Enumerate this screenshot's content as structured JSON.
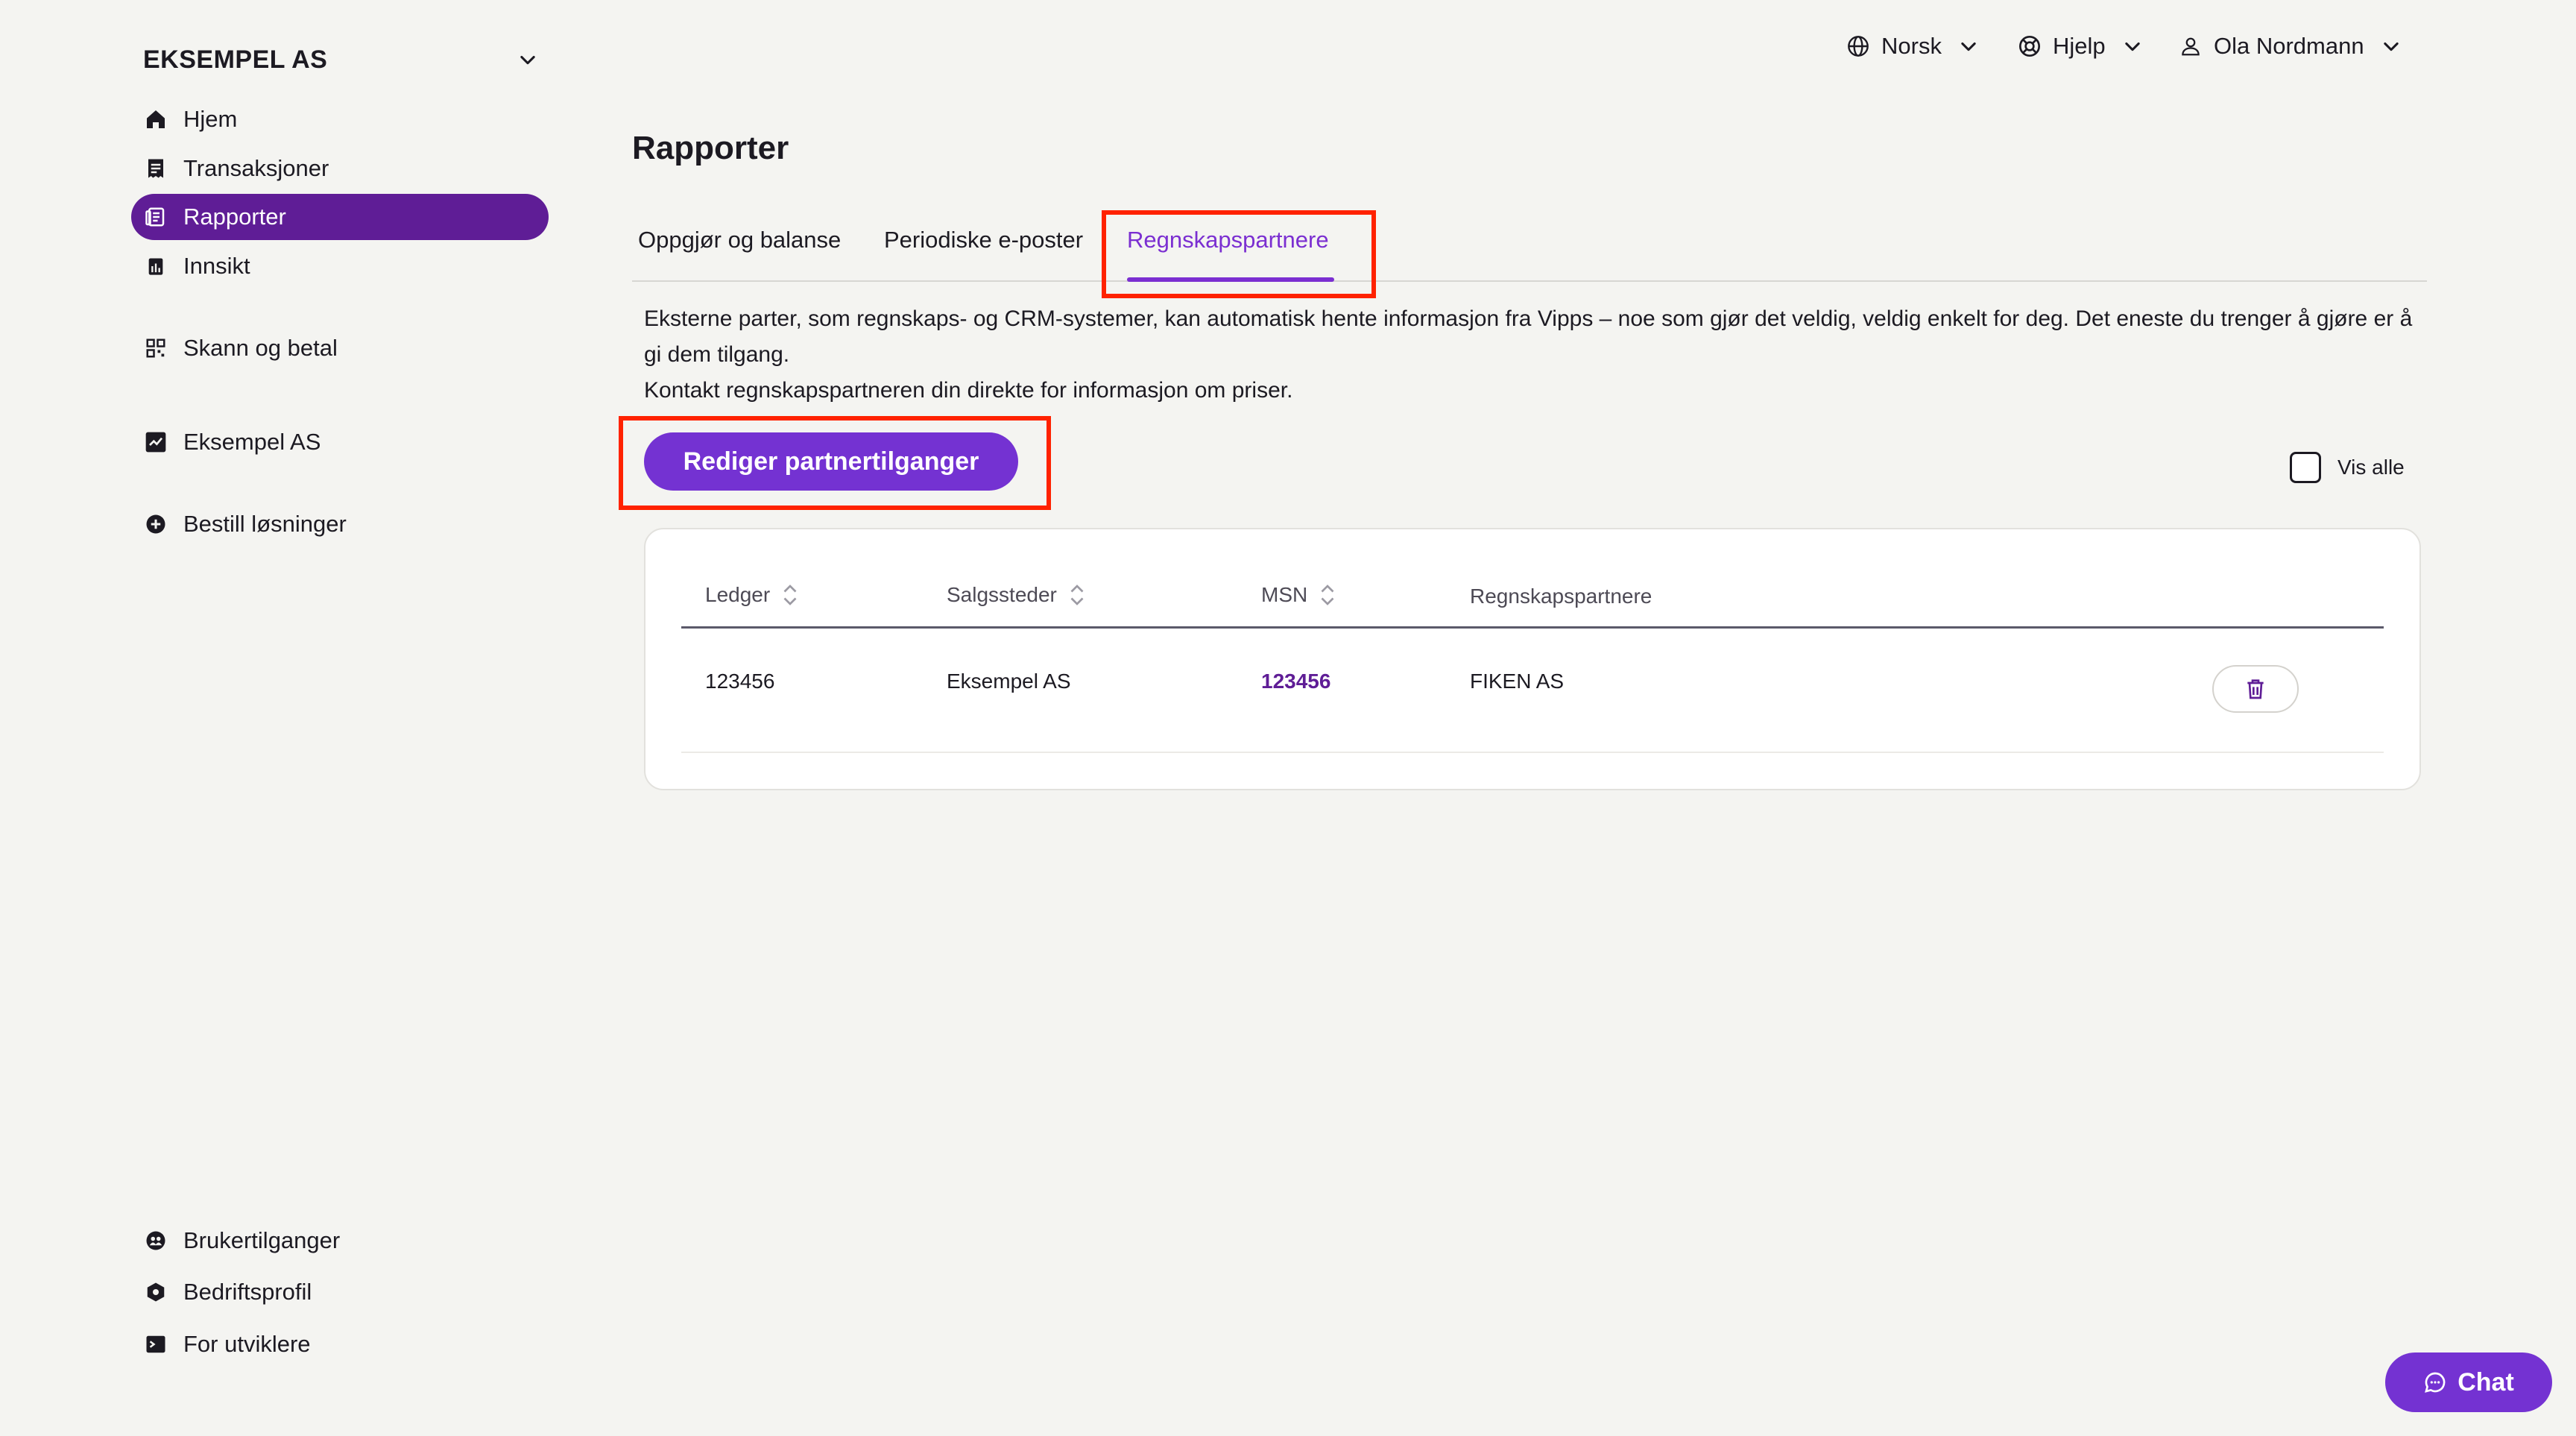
{
  "sidebar": {
    "company": "EKSEMPEL AS",
    "items": [
      {
        "label": "Hjem",
        "icon": "home-icon"
      },
      {
        "label": "Transaksjoner",
        "icon": "receipt-icon"
      },
      {
        "label": "Rapporter",
        "icon": "report-icon"
      },
      {
        "label": "Innsikt",
        "icon": "insight-icon"
      },
      {
        "label": "Skann og betal",
        "icon": "qr-icon"
      },
      {
        "label": "Eksempel AS",
        "icon": "store-icon"
      },
      {
        "label": "Bestill løsninger",
        "icon": "plus-circle-icon"
      }
    ],
    "bottom_items": [
      {
        "label": "Brukertilganger",
        "icon": "users-icon"
      },
      {
        "label": "Bedriftsprofil",
        "icon": "hexagon-icon"
      },
      {
        "label": "For utviklere",
        "icon": "terminal-icon"
      }
    ]
  },
  "topbar": {
    "language": "Norsk",
    "help": "Hjelp",
    "user": "Ola Nordmann"
  },
  "main": {
    "title": "Rapporter",
    "tabs": [
      {
        "label": "Oppgjør og balanse",
        "active": false
      },
      {
        "label": "Periodiske e-poster",
        "active": false
      },
      {
        "label": "Regnskapspartnere",
        "active": true
      }
    ],
    "description_line1": "Eksterne parter, som regnskaps- og CRM-systemer, kan automatisk hente informasjon fra Vipps – noe som gjør det veldig, veldig enkelt for deg. Det eneste du trenger å gjøre er å gi dem tilgang.",
    "description_line2": "Kontakt regnskapspartneren din direkte for informasjon om priser.",
    "edit_button": "Rediger partnertilganger",
    "show_all_label": "Vis alle",
    "show_all_checked": false
  },
  "table": {
    "columns": [
      "Ledger",
      "Salgssteder",
      "MSN",
      "Regnskapspartnere"
    ],
    "rows": [
      {
        "ledger": "123456",
        "salgssted": "Eksempel AS",
        "msn": "123456",
        "partner": "FIKEN AS"
      }
    ]
  },
  "chat": {
    "label": "Chat"
  },
  "colors": {
    "accent": "#7432d2",
    "active_nav": "#5f1d96",
    "highlight": "#ff2200",
    "background": "#f4f4f1"
  }
}
